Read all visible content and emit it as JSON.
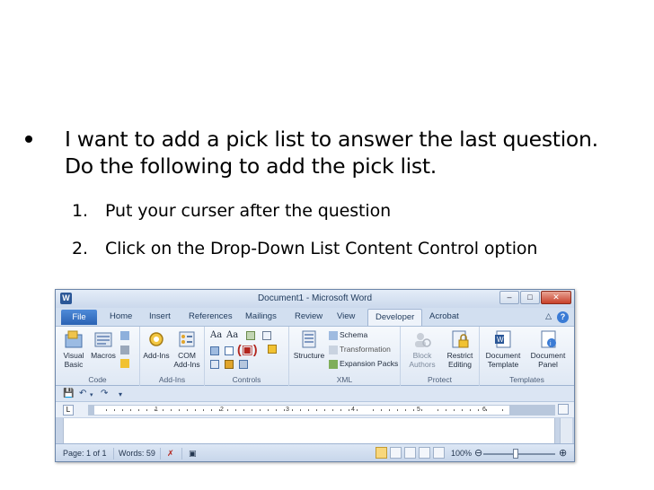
{
  "slide": {
    "bullet": "I want to add a pick list to answer the last question. Do the following to add the pick list.",
    "steps": [
      {
        "num": "1.",
        "text": "Put your curser after the question"
      },
      {
        "num": "2.",
        "text": "Click on the Drop-Down List Content Control option"
      }
    ]
  },
  "word": {
    "window_title": "Document1 - Microsoft Word",
    "app_icon": "W",
    "buttons": {
      "minimize": "–",
      "maximize": "□",
      "close": "✕"
    },
    "tabs": [
      "File",
      "Home",
      "Insert",
      "References",
      "Mailings",
      "Review",
      "View",
      "Developer",
      "Acrobat"
    ],
    "active_tab": "Developer",
    "groups": {
      "code": {
        "label": "Code",
        "visual_basic": "Visual Basic",
        "macros": "Macros"
      },
      "addins": {
        "label": "Add-Ins",
        "addins_btn": "Add-Ins",
        "com_addins": "COM Add-Ins"
      },
      "controls": {
        "label": "Controls",
        "aa1": "Aa",
        "aa2": "Aa"
      },
      "xml": {
        "label": "XML",
        "structure": "Structure",
        "schema": "Schema",
        "transformation": "Transformation",
        "expansion_packs": "Expansion Packs"
      },
      "protect": {
        "label": "Protect",
        "block_authors": "Block Authors",
        "restrict_editing": "Restrict Editing"
      },
      "templates": {
        "label": "Templates",
        "document_template": "Document Template",
        "document_panel": "Document Panel"
      }
    },
    "status": {
      "page": "Page: 1 of 1",
      "words": "Words: 59",
      "zoom": "100%",
      "zoom_level_percent": 100
    },
    "ruler_numbers": [
      "1",
      "2",
      "3",
      "4",
      "5",
      "6"
    ]
  }
}
